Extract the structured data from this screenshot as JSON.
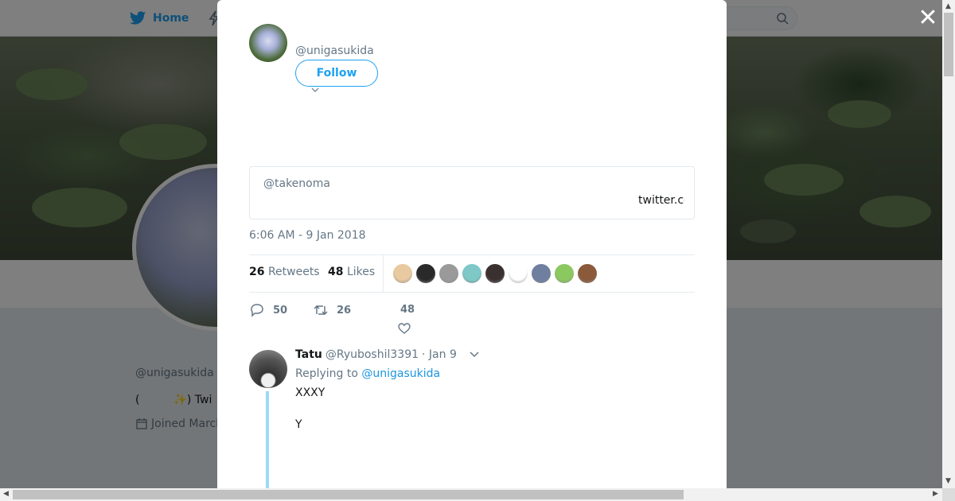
{
  "nav": {
    "home_label": "Home"
  },
  "profile": {
    "name": "",
    "handle": "@unigasukida",
    "bio": "(　　　✨) Twi",
    "joined": "Joined March"
  },
  "modal": {
    "close_symbol": "✕",
    "author_handle": "@unigasukida",
    "follow_label": "Follow",
    "tweet_text": "",
    "quote": {
      "handle": "@takenoma",
      "link": "twitter.com"
    },
    "timestamp": "6:06 AM - 9 Jan 2018",
    "stats": {
      "retweets_count": "26",
      "retweets_label": "Retweets",
      "likes_count": "48",
      "likes_label": "Likes"
    },
    "likers": [
      {
        "color": "#e8c9a0"
      },
      {
        "color": "#2a2a2a"
      },
      {
        "color": "#9a9a9a"
      },
      {
        "color": "#7ec8c8"
      },
      {
        "color": "#3a3030"
      },
      {
        "color": "#ffffff"
      },
      {
        "color": "#6e7fa0"
      },
      {
        "color": "#8cc860"
      },
      {
        "color": "#8a5a3a"
      }
    ],
    "actions": {
      "reply_count": "50",
      "retweet_count": "26",
      "like_count": "48"
    },
    "reply": {
      "name": "Tatu",
      "handle": "@Ryuboshil3391",
      "date": "· Jan 9",
      "replying_prefix": "Replying to",
      "replying_to": "@unigasukida",
      "line1": "XXXY",
      "line2": "Y"
    }
  },
  "colors": {
    "accent": "#1da1f2",
    "link": "#1b95e0",
    "thread": "#9dd9f8",
    "muted": "#657786"
  }
}
